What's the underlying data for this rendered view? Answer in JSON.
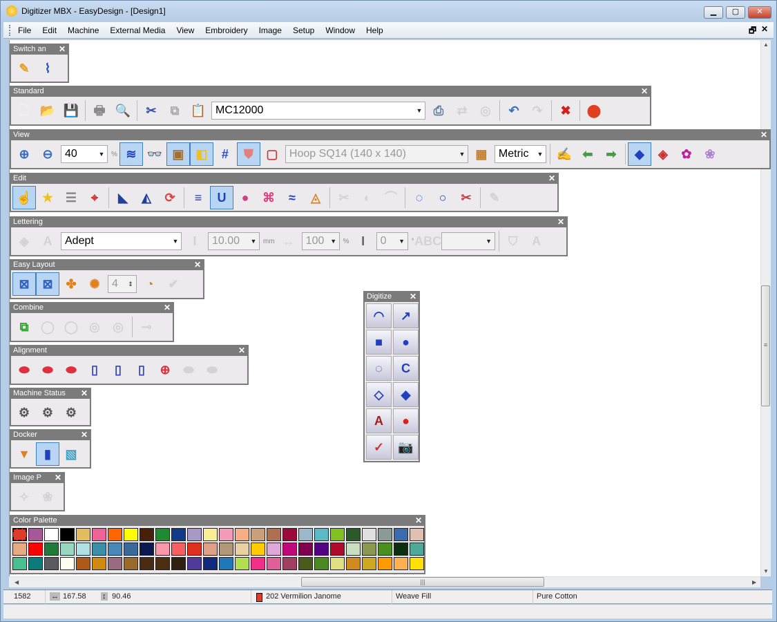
{
  "window": {
    "title": "Digitizer MBX - EasyDesign - [Design1]",
    "min": "▁",
    "max": "▢",
    "close": "✕",
    "mdi_restore": "🗗",
    "mdi_close": "✕"
  },
  "menu": [
    "File",
    "Edit",
    "Machine",
    "External Media",
    "View",
    "Embroidery",
    "Image",
    "Setup",
    "Window",
    "Help"
  ],
  "toolbars": [
    {
      "id": "switch",
      "title": "Switch an",
      "close": "✕",
      "items": [
        {
          "i": "pencil-icon",
          "c": "#e8a020",
          "t": "✎"
        },
        {
          "i": "stitch-mode-icon",
          "c": "#2050c0",
          "t": "⌇"
        }
      ]
    },
    {
      "id": "standard",
      "title": "Standard",
      "close": "✕",
      "items": [
        {
          "i": "new-file-icon",
          "c": "#f0f0f0",
          "t": "🗋"
        },
        {
          "i": "open-file-icon",
          "c": "#e0b030",
          "t": "📂"
        },
        {
          "i": "save-icon",
          "c": "#3a6ab0",
          "t": "💾"
        },
        {
          "s": 1
        },
        {
          "i": "print-icon",
          "c": "#888",
          "t": "🖶"
        },
        {
          "i": "print-preview-icon",
          "c": "#888",
          "t": "🔍"
        },
        {
          "s": 1
        },
        {
          "i": "cut-icon",
          "c": "#3050a0",
          "t": "✂"
        },
        {
          "i": "copy-icon",
          "c": "#aaa",
          "t": "⧉"
        },
        {
          "i": "paste-icon",
          "c": "#c8a050",
          "t": "📋"
        },
        {
          "combo": "machine",
          "v": "MC12000"
        },
        {
          "i": "send-to-machine-icon",
          "c": "#6080a0",
          "t": "⎙"
        },
        {
          "i": "transfer-icon",
          "c": "#aaa",
          "t": "⇄",
          "d": 1
        },
        {
          "i": "search-disabled-icon",
          "c": "#aaa",
          "t": "◎",
          "d": 1
        },
        {
          "s": 1
        },
        {
          "i": "undo-icon",
          "c": "#3a70c0",
          "t": "↶"
        },
        {
          "i": "redo-icon",
          "c": "#aaa",
          "t": "↷",
          "d": 1
        },
        {
          "s": 1
        },
        {
          "i": "cancel-icon",
          "c": "#d02020",
          "t": "✖"
        },
        {
          "s": 1
        },
        {
          "i": "stitch-player-icon",
          "c": "#e04020",
          "t": "⬤"
        }
      ]
    },
    {
      "id": "view",
      "title": "View",
      "close": "✕",
      "items": [
        {
          "i": "zoom-in-icon",
          "c": "#3a70c0",
          "t": "⊕"
        },
        {
          "i": "zoom-out-icon",
          "c": "#3a70c0",
          "t": "⊖"
        },
        {
          "combo": "zoom",
          "v": "40"
        },
        {
          "u": "%"
        },
        {
          "i": "show-stitches-icon",
          "c": "#2040c0",
          "t": "≋",
          "sel": 1
        },
        {
          "i": "3d-glasses-icon",
          "c": "#a05050",
          "t": "👓"
        },
        {
          "i": "show-image-icon",
          "c": "#a07030",
          "t": "▣",
          "sel": 1
        },
        {
          "i": "show-objects-icon",
          "c": "#f0c020",
          "t": "◧",
          "sel": 1
        },
        {
          "i": "grid-icon",
          "c": "#3050c0",
          "t": "#"
        },
        {
          "i": "hoop-icon",
          "c": "#e08080",
          "t": "⛊",
          "sel": 1
        },
        {
          "i": "hoop-outline-icon",
          "c": "#c04040",
          "t": "▢"
        },
        {
          "combo": "hoop",
          "v": "Hoop SQ14 (140 x 140)",
          "d": 1
        },
        {
          "i": "background-icon",
          "c": "#c08030",
          "t": "▦"
        },
        {
          "combo": "units",
          "v": "Metric"
        },
        {
          "s": 1
        },
        {
          "i": "edit-icon",
          "c": "#c04040",
          "t": "✍"
        },
        {
          "i": "previous-icon",
          "c": "#40a040",
          "t": "⬅"
        },
        {
          "i": "next-icon",
          "c": "#40a040",
          "t": "➡"
        },
        {
          "s": 1
        },
        {
          "i": "color-select-icon",
          "c": "#2040c0",
          "t": "◆",
          "sel": 1
        },
        {
          "i": "color-filter-icon",
          "c": "#d03030",
          "t": "◈"
        },
        {
          "i": "colors-icon",
          "c": "#c020a0",
          "t": "✿"
        },
        {
          "i": "flower-icon",
          "c": "#b080d0",
          "t": "❀"
        }
      ]
    },
    {
      "id": "edit",
      "title": "Edit",
      "close": "✕",
      "items": [
        {
          "i": "select-hand-icon",
          "c": "#888",
          "t": "☝",
          "sel": 1
        },
        {
          "i": "star-select-icon",
          "c": "#f0c020",
          "t": "★"
        },
        {
          "i": "list-icon",
          "c": "#888",
          "t": "☰"
        },
        {
          "i": "reshape-icon",
          "c": "#d03030",
          "t": "⌖"
        },
        {
          "s": 1
        },
        {
          "i": "mirror-horizontal-icon",
          "c": "#2040a0",
          "t": "◣"
        },
        {
          "i": "mirror-vertical-icon",
          "c": "#2040a0",
          "t": "◭"
        },
        {
          "i": "rotate-icon",
          "c": "#e04040",
          "t": "⟳"
        },
        {
          "s": 1
        },
        {
          "i": "satin-stitch-icon",
          "c": "#2040c0",
          "t": "≡"
        },
        {
          "i": "u-stitch-icon",
          "c": "#2040c0",
          "t": "U",
          "sel": 1
        },
        {
          "i": "radial-fill-icon",
          "c": "#d04080",
          "t": "●"
        },
        {
          "i": "cross-fill-icon",
          "c": "#e04080",
          "t": "⌘"
        },
        {
          "i": "wave-fill-icon",
          "c": "#2040c0",
          "t": "≈"
        },
        {
          "i": "applique-icon",
          "c": "#e08020",
          "t": "◬"
        },
        {
          "s": 1
        },
        {
          "i": "tool-disabled-1-icon",
          "c": "#aaa",
          "t": "✂",
          "d": 1
        },
        {
          "i": "tool-disabled-2-icon",
          "c": "#aaa",
          "t": "◐",
          "d": 1
        },
        {
          "i": "tool-disabled-3-icon",
          "c": "#aaa",
          "t": "⌒",
          "d": 1
        },
        {
          "s": 1
        },
        {
          "i": "add-point-icon",
          "c": "#2040c0",
          "t": "◌"
        },
        {
          "i": "circle-icon",
          "c": "#2040c0",
          "t": "○"
        },
        {
          "i": "knife-icon",
          "c": "#c04040",
          "t": "✂"
        },
        {
          "s": 1
        },
        {
          "i": "pin-icon",
          "c": "#aaa",
          "t": "✎",
          "d": 1
        }
      ]
    },
    {
      "id": "lettering",
      "title": "Lettering",
      "close": "✕",
      "items": [
        {
          "i": "lettering-icon",
          "c": "#aaa",
          "t": "◈",
          "d": 1
        },
        {
          "i": "monogram-icon",
          "c": "#aaa",
          "t": "A",
          "d": 1
        },
        {
          "combo": "font",
          "v": "Adept"
        },
        {
          "i": "height-icon",
          "c": "#aaa",
          "t": "I",
          "d": 1
        },
        {
          "combo": "height",
          "v": "10.00",
          "d": 1
        },
        {
          "u": "mm"
        },
        {
          "i": "width-icon",
          "c": "#aaa",
          "t": "↔",
          "d": 1
        },
        {
          "combo": "width",
          "v": "100",
          "d": 1
        },
        {
          "u": "%"
        },
        {
          "i": "italic-icon",
          "c": "#666",
          "t": "I"
        },
        {
          "combo": "angle",
          "v": "0",
          "d": 1
        },
        {
          "u": "°"
        },
        {
          "i": "spacing-icon",
          "c": "#aaa",
          "t": "ABC",
          "d": 1
        },
        {
          "combo": "spacing",
          "v": "",
          "d": 1
        },
        {
          "s": 1
        },
        {
          "i": "add-shape-icon",
          "c": "#aaa",
          "t": "⛉",
          "d": 1
        },
        {
          "i": "text-effect-icon",
          "c": "#aaa",
          "t": "A",
          "d": 1
        }
      ]
    },
    {
      "id": "easylayout",
      "title": "Easy Layout",
      "close": "✕",
      "items": [
        {
          "i": "layout-grid-icon",
          "c": "#3060c0",
          "t": "⊠",
          "sel": 1
        },
        {
          "i": "layout-grid-2-icon",
          "c": "#3060c0",
          "t": "⊠",
          "sel": 1
        },
        {
          "i": "quarter-icon",
          "c": "#e08020",
          "t": "✤"
        },
        {
          "i": "circle-layout-icon",
          "c": "#e08020",
          "t": "✺"
        },
        {
          "combo": "count",
          "v": "4",
          "d": 1
        },
        {
          "i": "pie-icon",
          "c": "#e08020",
          "t": "◔"
        },
        {
          "i": "ok-icon",
          "c": "#aaa",
          "t": "✔",
          "d": 1
        }
      ]
    },
    {
      "id": "combine",
      "title": "Combine",
      "close": "✕",
      "items": [
        {
          "i": "combine-icon",
          "c": "#30a030",
          "t": "⧉"
        },
        {
          "i": "combine-add-icon",
          "c": "#aaa",
          "t": "◯",
          "d": 1
        },
        {
          "i": "combine-subtract-icon",
          "c": "#aaa",
          "t": "◯",
          "d": 1
        },
        {
          "i": "combine-intersect-icon",
          "c": "#aaa",
          "t": "◎",
          "d": 1
        },
        {
          "i": "combine-exclude-icon",
          "c": "#aaa",
          "t": "◎",
          "d": 1
        },
        {
          "s": 1
        },
        {
          "i": "combine-other-icon",
          "c": "#aaa",
          "t": "⊸",
          "d": 1
        }
      ]
    },
    {
      "id": "alignment",
      "title": "Alignment",
      "close": "✕",
      "items": [
        {
          "i": "align-left-icon",
          "c": "#e03040",
          "t": "⬬"
        },
        {
          "i": "align-center-icon",
          "c": "#e03040",
          "t": "⬬"
        },
        {
          "i": "align-right-icon",
          "c": "#e03040",
          "t": "⬬"
        },
        {
          "i": "align-top-icon",
          "c": "#3040c0",
          "t": "▯"
        },
        {
          "i": "align-middle-icon",
          "c": "#3040c0",
          "t": "▯"
        },
        {
          "i": "align-bottom-icon",
          "c": "#3040c0",
          "t": "▯"
        },
        {
          "i": "align-center-both-icon",
          "c": "#e03040",
          "t": "⊕"
        },
        {
          "i": "distribute-h-icon",
          "c": "#aaa",
          "t": "⬬",
          "d": 1
        },
        {
          "i": "distribute-v-icon",
          "c": "#aaa",
          "t": "⬬",
          "d": 1
        }
      ]
    },
    {
      "id": "machinestatus",
      "title": "Machine Status",
      "close": "✕",
      "items": [
        {
          "i": "machine-1-icon",
          "c": "#555",
          "t": "⚙"
        },
        {
          "i": "machine-2-icon",
          "c": "#555",
          "t": "⚙"
        },
        {
          "i": "machine-3-icon",
          "c": "#555",
          "t": "⚙"
        }
      ]
    },
    {
      "id": "docker",
      "title": "Docker",
      "close": "✕",
      "items": [
        {
          "i": "sequence-icon",
          "c": "#e08020",
          "t": "▼"
        },
        {
          "i": "thread-icon",
          "c": "#2040c0",
          "t": "▮",
          "sel": 1
        },
        {
          "i": "images-icon",
          "c": "#40a0c0",
          "t": "▧"
        }
      ]
    },
    {
      "id": "imagep",
      "title": "Image P",
      "close": "✕",
      "items": [
        {
          "i": "image-process-icon",
          "c": "#aaa",
          "t": "✧",
          "d": 1
        },
        {
          "i": "image-flower-icon",
          "c": "#aaa",
          "t": "❀",
          "d": 1
        }
      ]
    },
    {
      "id": "digitize",
      "title": "Digitize",
      "close": "✕",
      "items": [
        {
          "i": "digitize-satin-arc-icon",
          "c": "#2040c0",
          "t": "◠"
        },
        {
          "i": "digitize-satin-line-icon",
          "c": "#2040c0",
          "t": "↗"
        },
        {
          "i": "digitize-square-icon",
          "c": "#2040c0",
          "t": "■"
        },
        {
          "i": "digitize-circle-icon",
          "c": "#2040c0",
          "t": "●"
        },
        {
          "i": "digitize-running-arc-icon",
          "c": "#2040c0",
          "t": "◌"
        },
        {
          "i": "digitize-c-icon",
          "c": "#2040c0",
          "t": "C"
        },
        {
          "i": "digitize-diamond-icon",
          "c": "#2040c0",
          "t": "◇"
        },
        {
          "i": "digitize-diamond-fill-icon",
          "c": "#2040c0",
          "t": "◆"
        },
        {
          "i": "applique-shield-icon",
          "c": "#a02020",
          "t": "A"
        },
        {
          "i": "apple-icon",
          "c": "#e02020",
          "t": "●"
        },
        {
          "i": "pick-icon",
          "c": "#d03030",
          "t": "✓"
        },
        {
          "i": "camera-icon",
          "c": "#555",
          "t": "📷"
        }
      ]
    }
  ],
  "palette": {
    "title": "Color Palette",
    "close": "✕",
    "colors": [
      "#e03a2a",
      "#a8579a",
      "#ffffff",
      "#000000",
      "#e2bc5e",
      "#f0629a",
      "#ff6600",
      "#ffff00",
      "#4a1e08",
      "#1e8a32",
      "#103a8a",
      "#a89ac8",
      "#f8ee94",
      "#f59ab8",
      "#f8ae84",
      "#caa07a",
      "#b07050",
      "#9a0a3a",
      "#9ab8cc",
      "#5abac6",
      "#80c020",
      "#2a5a2a",
      "#e0e0e0",
      "#8a9a96",
      "#3a6ab0",
      "#e0c0b0",
      "#e8aa80",
      "#ff0000",
      "#207a3a",
      "#98d8c0",
      "#b0e0e4",
      "#3a90a8",
      "#4a88b8",
      "#3a6a9a",
      "#0a1a50",
      "#f898a8",
      "#f86060",
      "#e03020",
      "#e0a088",
      "#b09878",
      "#e8d0a0",
      "#ffcc00",
      "#e0a8d8",
      "#c0087a",
      "#800050",
      "#500080",
      "#b00a2a",
      "#c8e0c0",
      "#8a9a50",
      "#4a9020",
      "#0a3010",
      "#50a898",
      "#48c090",
      "#0a7a7a",
      "#5a5a60",
      "#fffff0",
      "#b05a1a",
      "#d08a10",
      "#9a6a80",
      "#9a6a2a",
      "#4a2a10",
      "#4a3010",
      "#302010",
      "#503a9a",
      "#102a80",
      "#2078b8",
      "#b0e050",
      "#f03088",
      "#e0609a",
      "#a04060",
      "#4a5a1a",
      "#4a8a20",
      "#e0e080",
      "#d08a20",
      "#d0a820",
      "#ff9a00",
      "#ffb050",
      "#ffe000"
    ]
  },
  "status": {
    "stitches": "1582",
    "width": "167.58",
    "height": "90.46",
    "thread": "202 Vermilion Janome",
    "thread_color": "#e03a2a",
    "fill": "Weave Fill",
    "fabric": "Pure Cotton"
  }
}
